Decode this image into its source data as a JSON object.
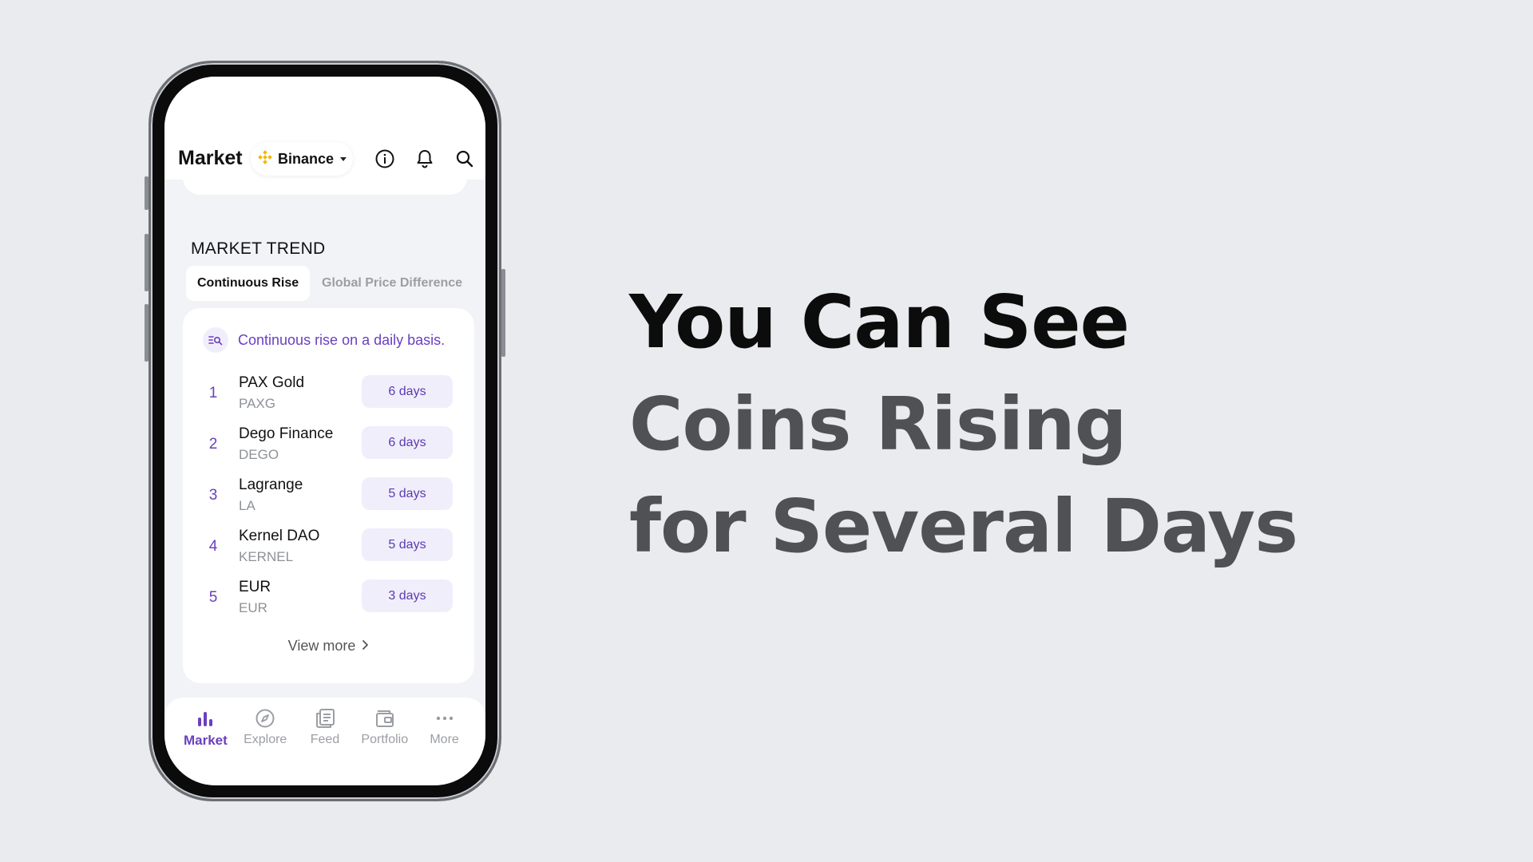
{
  "header": {
    "title": "Market",
    "exchange": {
      "name": "Binance",
      "icon": "binance-logo-icon",
      "brand_color": "#F0B90B"
    },
    "icons": [
      "info-icon",
      "bell-icon",
      "search-icon"
    ]
  },
  "market_trend": {
    "section_title": "MARKET TREND",
    "tabs": [
      {
        "label": "Continuous Rise",
        "active": true
      },
      {
        "label": "Global Price Difference",
        "active": false
      }
    ],
    "hint": "Continuous rise on a daily basis.",
    "coins": [
      {
        "rank": "1",
        "name": "PAX Gold",
        "symbol": "PAXG",
        "days": "6 days"
      },
      {
        "rank": "2",
        "name": "Dego Finance",
        "symbol": "DEGO",
        "days": "6 days"
      },
      {
        "rank": "3",
        "name": "Lagrange",
        "symbol": "LA",
        "days": "5 days"
      },
      {
        "rank": "4",
        "name": "Kernel DAO",
        "symbol": "KERNEL",
        "days": "5 days"
      },
      {
        "rank": "5",
        "name": "EUR",
        "symbol": "EUR",
        "days": "3 days"
      }
    ],
    "view_more": "View more"
  },
  "bottom_nav": [
    {
      "label": "Market",
      "icon": "bar-chart-icon",
      "active": true
    },
    {
      "label": "Explore",
      "icon": "compass-icon",
      "active": false
    },
    {
      "label": "Feed",
      "icon": "news-icon",
      "active": false
    },
    {
      "label": "Portfolio",
      "icon": "wallet-icon",
      "active": false
    },
    {
      "label": "More",
      "icon": "more-dots-icon",
      "active": false
    }
  ],
  "headline": {
    "line1": "You Can See",
    "line2": "Coins Rising",
    "line3": "for Several Days"
  },
  "colors": {
    "accent": "#6A3FBF",
    "background": "#E9EBEE",
    "badge_bg": "#F1EEFB"
  }
}
